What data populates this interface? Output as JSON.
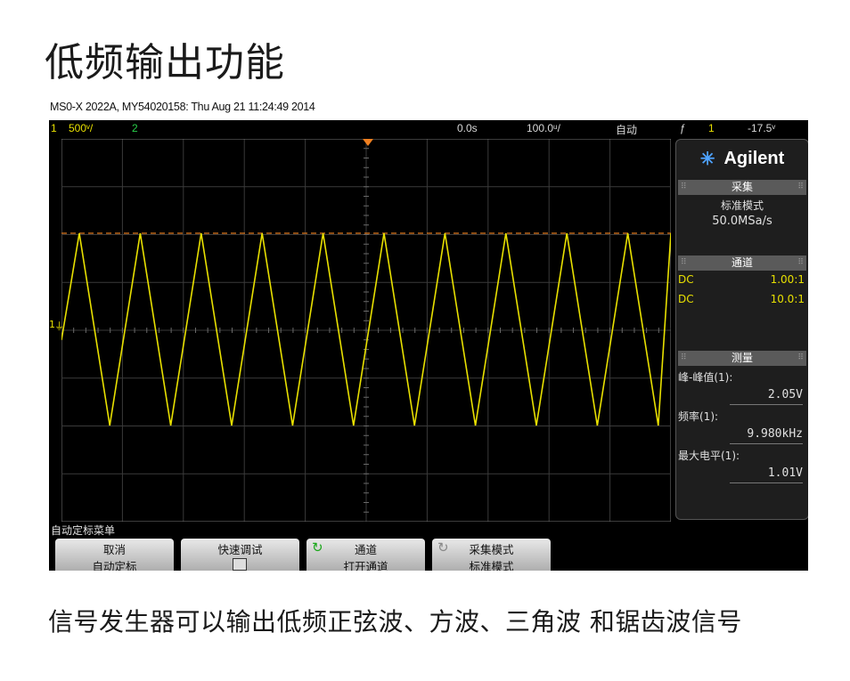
{
  "title": "低频输出功能",
  "scope_header": "MS0-X 2022A, MY54020158: Thu Aug 21 11:24:49 2014",
  "statusbar": {
    "ch1_num": "1",
    "ch1_scale": "500ᵛ/",
    "ch2_num": "2",
    "time_offset": "0.0s",
    "time_scale": "100.0ᵘ/",
    "trigger_mode": "自动",
    "trigger_icon": "ƒ",
    "trigger_channel": "1",
    "trigger_level": "-17.5ᵛ"
  },
  "ground_marker": "1",
  "side_panel": {
    "brand": "Agilent",
    "acquisition": {
      "header": "采集",
      "mode": "标准模式",
      "rate": "50.0MSa/s"
    },
    "channels": {
      "header": "通道",
      "rows": [
        {
          "coupling": "DC",
          "probe": "1.00:1"
        },
        {
          "coupling": "DC",
          "probe": "10.0:1"
        }
      ]
    },
    "measure": {
      "header": "测量",
      "items": [
        {
          "label": "峰-峰值(1):",
          "value": "2.05V"
        },
        {
          "label": "频率(1):",
          "value": "9.980kHz"
        },
        {
          "label": "最大电平(1):",
          "value": "1.01V"
        }
      ]
    }
  },
  "menu": {
    "title": "自动定标菜单",
    "softkeys": [
      {
        "line1": "取消",
        "line2": "自动定标"
      },
      {
        "line1": "快速调试",
        "line2": ""
      },
      {
        "line1": "通道",
        "line2": "打开通道"
      },
      {
        "line1": "采集模式",
        "line2": "标准模式"
      }
    ]
  },
  "caption": "信号发生器可以输出低频正弦波、方波、三角波 和锯齿波信号",
  "colors": {
    "ch1": "#e8e000",
    "ch2": "#29d14a",
    "trigger_level_line": "#e07a1f"
  },
  "waveform": {
    "type": "triangle",
    "frequency": "9.980kHz",
    "peak_to_peak": "2.05V",
    "max": "1.01V"
  }
}
